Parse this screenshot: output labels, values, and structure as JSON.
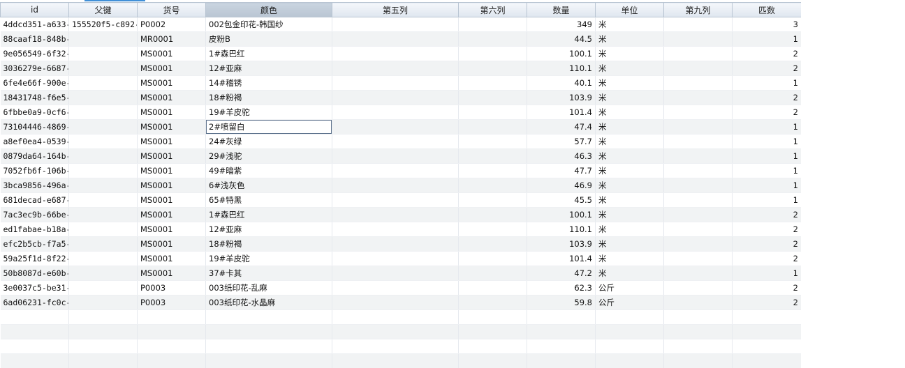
{
  "columns": [
    {
      "key": "id",
      "label": "id"
    },
    {
      "key": "parent_key",
      "label": "父键"
    },
    {
      "key": "item_no",
      "label": "货号"
    },
    {
      "key": "color",
      "label": "颜色"
    },
    {
      "key": "col5",
      "label": "第五列"
    },
    {
      "key": "col6",
      "label": "第六列"
    },
    {
      "key": "qty",
      "label": "数量"
    },
    {
      "key": "unit",
      "label": "单位"
    },
    {
      "key": "col9",
      "label": "第九列"
    },
    {
      "key": "pieces",
      "label": "匹数"
    }
  ],
  "sorted_column": "color",
  "editing_cell": {
    "row": 7,
    "column": "color"
  },
  "rows": [
    {
      "id": "4ddcd351-a633-",
      "parent_key": "155520f5-c892-",
      "item_no": "P0002",
      "color": "002包金印花-韩国纱",
      "col5": "",
      "col6": "",
      "qty": "349",
      "unit": "米",
      "col9": "",
      "pieces": "3"
    },
    {
      "id": "88caaf18-848b-",
      "parent_key": "",
      "item_no": "MR0001",
      "color": "皮粉B",
      "col5": "",
      "col6": "",
      "qty": "44.5",
      "unit": "米",
      "col9": "",
      "pieces": "1"
    },
    {
      "id": "9e056549-6f32-",
      "parent_key": "",
      "item_no": "MS0001",
      "color": "1#森巴红",
      "col5": "",
      "col6": "",
      "qty": "100.1",
      "unit": "米",
      "col9": "",
      "pieces": "2"
    },
    {
      "id": "3036279e-6687-",
      "parent_key": "",
      "item_no": "MS0001",
      "color": "12#亚麻",
      "col5": "",
      "col6": "",
      "qty": "110.1",
      "unit": "米",
      "col9": "",
      "pieces": "2"
    },
    {
      "id": "6fe4e66f-900e-",
      "parent_key": "",
      "item_no": "MS0001",
      "color": "14#稽锈",
      "col5": "",
      "col6": "",
      "qty": "40.1",
      "unit": "米",
      "col9": "",
      "pieces": "1"
    },
    {
      "id": "18431748-f6e5-",
      "parent_key": "",
      "item_no": "MS0001",
      "color": "18#粉褐",
      "col5": "",
      "col6": "",
      "qty": "103.9",
      "unit": "米",
      "col9": "",
      "pieces": "2"
    },
    {
      "id": "6fbbe0a9-0cf6-",
      "parent_key": "",
      "item_no": "MS0001",
      "color": "19#羊皮驼",
      "col5": "",
      "col6": "",
      "qty": "101.4",
      "unit": "米",
      "col9": "",
      "pieces": "2"
    },
    {
      "id": "73104446-4869-",
      "parent_key": "",
      "item_no": "MS0001",
      "color": "2#喷留白",
      "col5": "",
      "col6": "",
      "qty": "47.4",
      "unit": "米",
      "col9": "",
      "pieces": "1"
    },
    {
      "id": "a8ef0ea4-0539-",
      "parent_key": "",
      "item_no": "MS0001",
      "color": "24#灰绿",
      "col5": "",
      "col6": "",
      "qty": "57.7",
      "unit": "米",
      "col9": "",
      "pieces": "1"
    },
    {
      "id": "0879da64-164b-",
      "parent_key": "",
      "item_no": "MS0001",
      "color": "29#浅驼",
      "col5": "",
      "col6": "",
      "qty": "46.3",
      "unit": "米",
      "col9": "",
      "pieces": "1"
    },
    {
      "id": "7052fb6f-106b-",
      "parent_key": "",
      "item_no": "MS0001",
      "color": "49#暗紫",
      "col5": "",
      "col6": "",
      "qty": "47.7",
      "unit": "米",
      "col9": "",
      "pieces": "1"
    },
    {
      "id": "3bca9856-496a-",
      "parent_key": "",
      "item_no": "MS0001",
      "color": "6#浅灰色",
      "col5": "",
      "col6": "",
      "qty": "46.9",
      "unit": "米",
      "col9": "",
      "pieces": "1"
    },
    {
      "id": "681decad-e687-",
      "parent_key": "",
      "item_no": "MS0001",
      "color": "65#特黑",
      "col5": "",
      "col6": "",
      "qty": "45.5",
      "unit": "米",
      "col9": "",
      "pieces": "1"
    },
    {
      "id": "7ac3ec9b-66be-",
      "parent_key": "",
      "item_no": "MS0001",
      "color": "1#森巴红",
      "col5": "",
      "col6": "",
      "qty": "100.1",
      "unit": "米",
      "col9": "",
      "pieces": "2"
    },
    {
      "id": "ed1fabae-b18a-",
      "parent_key": "",
      "item_no": "MS0001",
      "color": "12#亚麻",
      "col5": "",
      "col6": "",
      "qty": "110.1",
      "unit": "米",
      "col9": "",
      "pieces": "2"
    },
    {
      "id": "efc2b5cb-f7a5-",
      "parent_key": "",
      "item_no": "MS0001",
      "color": "18#粉褐",
      "col5": "",
      "col6": "",
      "qty": "103.9",
      "unit": "米",
      "col9": "",
      "pieces": "2"
    },
    {
      "id": "59a25f1d-8f22-",
      "parent_key": "",
      "item_no": "MS0001",
      "color": "19#羊皮驼",
      "col5": "",
      "col6": "",
      "qty": "101.4",
      "unit": "米",
      "col9": "",
      "pieces": "2"
    },
    {
      "id": "50b8087d-e60b-",
      "parent_key": "",
      "item_no": "MS0001",
      "color": "37#卡其",
      "col5": "",
      "col6": "",
      "qty": "47.2",
      "unit": "米",
      "col9": "",
      "pieces": "1"
    },
    {
      "id": "3e0037c5-be31-",
      "parent_key": "",
      "item_no": "P0003",
      "color": "003纸印花-乱麻",
      "col5": "",
      "col6": "",
      "qty": "62.3",
      "unit": "公斤",
      "col9": "",
      "pieces": "2"
    },
    {
      "id": "6ad06231-fc0c-",
      "parent_key": "",
      "item_no": "P0003",
      "color": "003纸印花-水晶麻",
      "col5": "",
      "col6": "",
      "qty": "59.8",
      "unit": "公斤",
      "col9": "",
      "pieces": "2"
    }
  ],
  "empty_rows": 4,
  "colors": {
    "header_bg": "#dfe6ef",
    "sorted_header_bg": "#b9c5d2",
    "stripe": "#f1f3f4",
    "editor_border": "#5a6f8a",
    "accent": "#3f8fd8"
  }
}
